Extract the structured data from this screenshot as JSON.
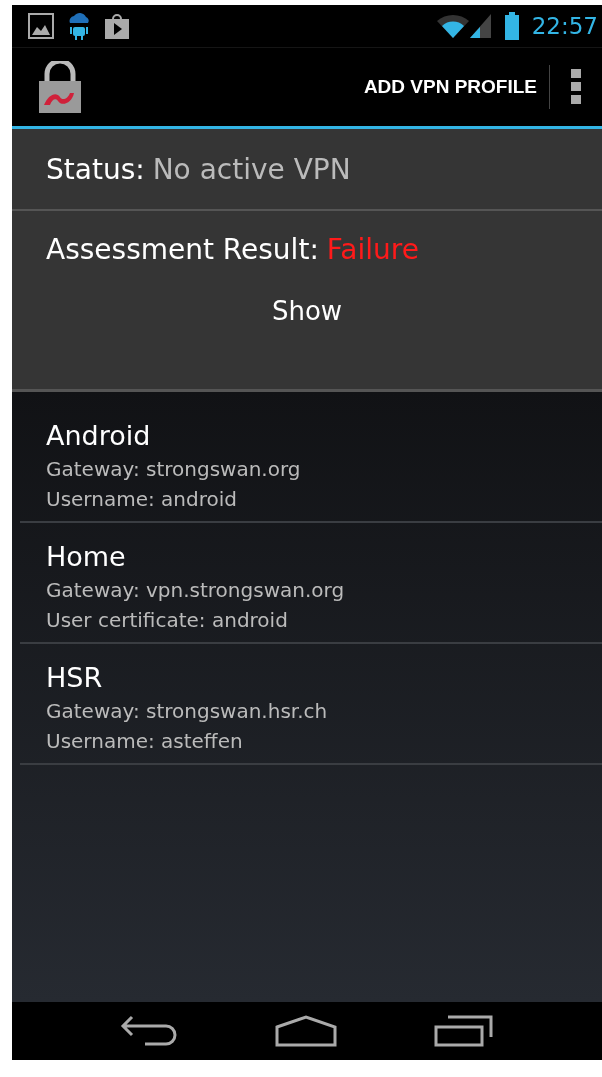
{
  "status_bar": {
    "time": "22:57"
  },
  "action_bar": {
    "action": "ADD VPN PROFILE"
  },
  "status": {
    "label": "Status:",
    "value": "No active VPN"
  },
  "assessment": {
    "label": "Assessment Result:",
    "value": "Failure",
    "kind": "failure",
    "button": "Show"
  },
  "profiles": [
    {
      "name": "Android",
      "lines": [
        "Gateway: strongswan.org",
        "Username: android"
      ]
    },
    {
      "name": "Home",
      "lines": [
        "Gateway: vpn.strongswan.org",
        "User certificate: android"
      ]
    },
    {
      "name": "HSR",
      "lines": [
        "Gateway: strongswan.hsr.ch",
        "Username: asteffen"
      ]
    }
  ]
}
